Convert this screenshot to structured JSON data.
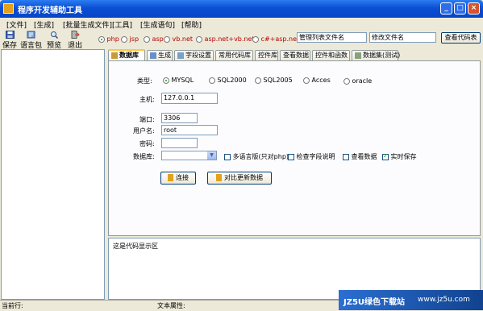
{
  "window": {
    "title": "程序开发辅助工具",
    "controls": [
      "_",
      "□",
      "×"
    ]
  },
  "menu": [
    "[文件]",
    "[生成]",
    "[批量生成文件]",
    "[工具]",
    "[生成语句]",
    "[帮助]"
  ],
  "toolbar": {
    "save": "保存",
    "langpack": "语言包",
    "preview": "预览",
    "exit": "退出",
    "languages": [
      "php",
      "jsp",
      "asp",
      "vb.net",
      "asp.net+vb.net",
      "c#+asp.net"
    ],
    "selected_language": "php",
    "list_file_input": "管理列表文件名",
    "edit_file_input": "修改文件名",
    "view_code_table": "查看代码表"
  },
  "tabs": [
    "数据库",
    "生成",
    "字段设置",
    "常用代码库",
    "控件库",
    "查看数据",
    "控件和函数",
    "数据集(测试)"
  ],
  "db": {
    "type_label": "类型:",
    "types": [
      "MYSQL",
      "SQL2000",
      "SQL2005",
      "Acces",
      "oracle"
    ],
    "selected_type": "MYSQL",
    "host_label": "主机:",
    "host_value": "127.0.0.1",
    "port_label": "端口:",
    "port_value": "3306",
    "user_label": "用户名:",
    "user_value": "root",
    "password_label": "密码:",
    "password_value": "",
    "database_label": "数据库:",
    "database_value": "",
    "options": [
      {
        "label": "多语言版(只对php)",
        "checked": false
      },
      {
        "label": "检查字段说明",
        "checked": false
      },
      {
        "label": "查看数据",
        "checked": false
      },
      {
        "label": "实时保存",
        "checked": true
      }
    ],
    "connect_button": "连接",
    "compare_button": "对比更新数据"
  },
  "code_area": {
    "text": "这是代码显示区"
  },
  "status": {
    "current_row": "当前行:",
    "text_attr": "文本属性:"
  },
  "watermark": {
    "text": "JZ5U绿色下载站",
    "url": "www.jz5u.com"
  }
}
